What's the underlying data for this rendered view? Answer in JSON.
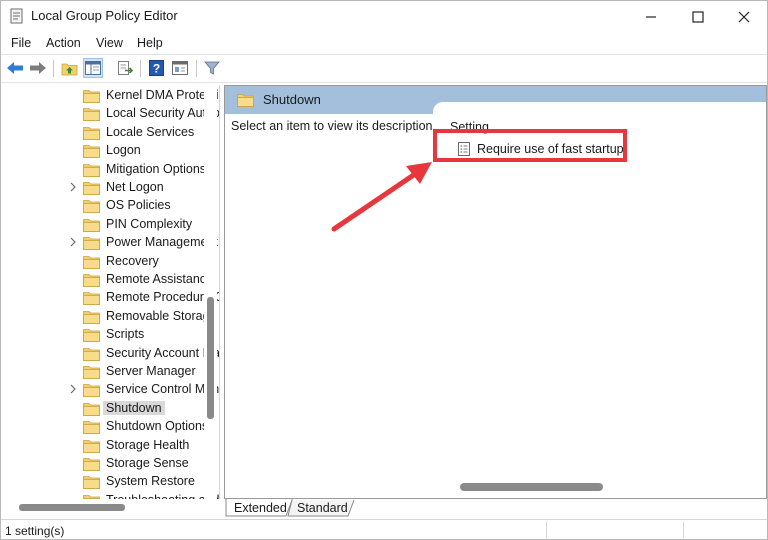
{
  "window": {
    "title": "Local Group Policy Editor"
  },
  "menu": [
    "File",
    "Action",
    "View",
    "Help"
  ],
  "toolbar": {
    "buttons": [
      "back-arrow-icon",
      "forward-arrow-icon",
      "up-folder-icon",
      "show-hide-tree-icon",
      "export-list-icon",
      "help-icon",
      "properties-view-icon",
      "filter-icon"
    ]
  },
  "tree": {
    "items": [
      {
        "label": "Kernel DMA Protection",
        "expandable": false
      },
      {
        "label": "Local Security Authority",
        "expandable": false
      },
      {
        "label": "Locale Services",
        "expandable": false
      },
      {
        "label": "Logon",
        "expandable": false
      },
      {
        "label": "Mitigation Options",
        "expandable": false
      },
      {
        "label": "Net Logon",
        "expandable": true
      },
      {
        "label": "OS Policies",
        "expandable": false
      },
      {
        "label": "PIN Complexity",
        "expandable": false
      },
      {
        "label": "Power Management",
        "expandable": true
      },
      {
        "label": "Recovery",
        "expandable": false
      },
      {
        "label": "Remote Assistance",
        "expandable": false
      },
      {
        "label": "Remote Procedure Call",
        "expandable": false
      },
      {
        "label": "Removable Storage Access",
        "expandable": false
      },
      {
        "label": "Scripts",
        "expandable": false
      },
      {
        "label": "Security Account Manager",
        "expandable": false
      },
      {
        "label": "Server Manager",
        "expandable": false
      },
      {
        "label": "Service Control Manager Settings",
        "expandable": true
      },
      {
        "label": "Shutdown",
        "expandable": false,
        "selected": true
      },
      {
        "label": "Shutdown Options",
        "expandable": false
      },
      {
        "label": "Storage Health",
        "expandable": false
      },
      {
        "label": "Storage Sense",
        "expandable": false
      },
      {
        "label": "System Restore",
        "expandable": false
      },
      {
        "label": "Troubleshooting and Diagnostics",
        "expandable": false
      }
    ]
  },
  "panel": {
    "header": "Shutdown",
    "description": "Select an item to view its description.",
    "column_header": "Setting",
    "settings": [
      {
        "label": "Require use of fast startup"
      }
    ]
  },
  "tabs": [
    "Extended",
    "Standard"
  ],
  "status": {
    "text": "1 setting(s)"
  },
  "colors": {
    "header_bar": "#a4bfdc",
    "selection": "#d9d9d9",
    "callout": "#e8363d",
    "folder": "#f3cf6e"
  }
}
